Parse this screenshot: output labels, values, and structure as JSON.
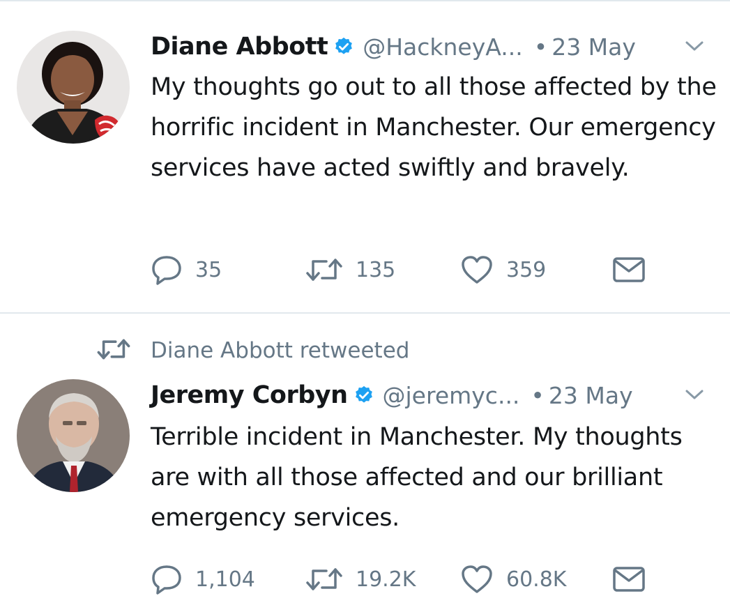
{
  "tweets": [
    {
      "author_name": "Diane Abbott",
      "handle": "@HackneyA...",
      "separator": "•",
      "date": "23 May",
      "verified": true,
      "text": "My thoughts go out to all those affected by the horrific incident in Manchester. Our emergency services have acted swiftly and bravely.",
      "replies": "35",
      "retweets": "135",
      "likes": "359",
      "icons": {
        "reply": "reply-icon",
        "retweet": "retweet-icon",
        "like": "heart-icon",
        "dm": "envelope-icon",
        "menu": "chevron-down-icon"
      }
    },
    {
      "retweeted_by": "Diane Abbott retweeted",
      "author_name": "Jeremy Corbyn",
      "handle": "@jeremyc...",
      "separator": "•",
      "date": "23 May",
      "verified": true,
      "text": "Terrible incident in Manchester. My thoughts are with all those affected and our brilliant emergency services.",
      "replies": "1,104",
      "retweets": "19.2K",
      "likes": "60.8K",
      "icons": {
        "reply": "reply-icon",
        "retweet": "retweet-icon",
        "like": "heart-icon",
        "dm": "envelope-icon",
        "menu": "chevron-down-icon"
      }
    }
  ],
  "colors": {
    "text": "#14171a",
    "secondary": "#657786",
    "verified": "#1da1f2",
    "divider": "#e1e8ed"
  }
}
